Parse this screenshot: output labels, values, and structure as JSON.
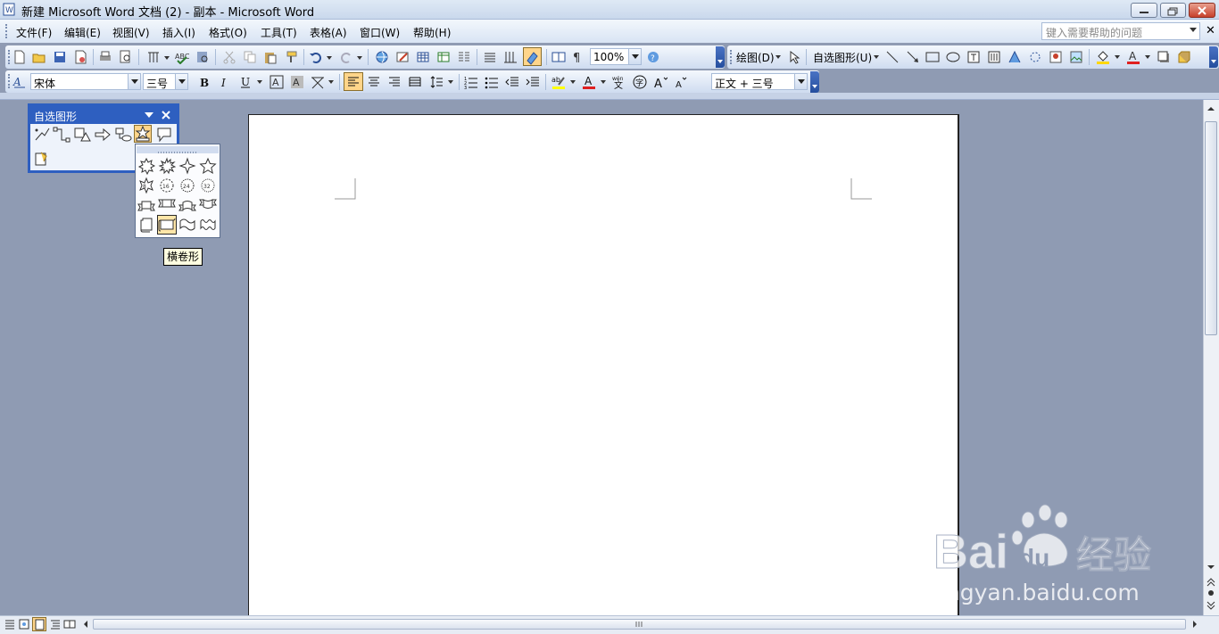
{
  "window": {
    "title": "新建 Microsoft Word 文档 (2) - 副本 - Microsoft Word"
  },
  "menu": {
    "items": [
      "文件(F)",
      "编辑(E)",
      "视图(V)",
      "插入(I)",
      "格式(O)",
      "工具(T)",
      "表格(A)",
      "窗口(W)",
      "帮助(H)"
    ],
    "help_placeholder": "键入需要帮助的问题"
  },
  "standard_toolbar": {
    "zoom": "100%"
  },
  "drawing_toolbar": {
    "draw_label": "绘图(D)",
    "autoshapes_label": "自选图形(U)"
  },
  "format_toolbar": {
    "font_name": "宋体",
    "font_size": "三号",
    "style": "正文 + 三号"
  },
  "autoshapes_panel": {
    "title": "自选图形",
    "icons": [
      "lines-icon",
      "connectors-icon",
      "basic-shapes-icon",
      "block-arrows-icon",
      "flowchart-icon",
      "stars-banners-icon",
      "callouts-icon"
    ],
    "more_icon": "more-autoshapes-icon"
  },
  "stars_banners_submenu": {
    "shapes": [
      "explosion-1-icon",
      "explosion-2-icon",
      "4-point-star-icon",
      "5-point-star-icon",
      "8-point-star-icon",
      "16-point-star-icon",
      "24-point-star-icon",
      "32-point-star-icon",
      "up-ribbon-icon",
      "down-ribbon-icon",
      "curved-up-ribbon-icon",
      "curved-down-ribbon-icon",
      "vertical-scroll-icon",
      "horizontal-scroll-icon",
      "wave-icon",
      "double-wave-icon"
    ],
    "selected": "horizontal-scroll-icon",
    "tooltip": "横卷形"
  },
  "watermark": {
    "url": "jingyan.baidu.com"
  },
  "colors": {
    "panel_blue": "#2e5fc0",
    "workspace": "#8f9bb3",
    "highlight": "#ffd58a"
  }
}
